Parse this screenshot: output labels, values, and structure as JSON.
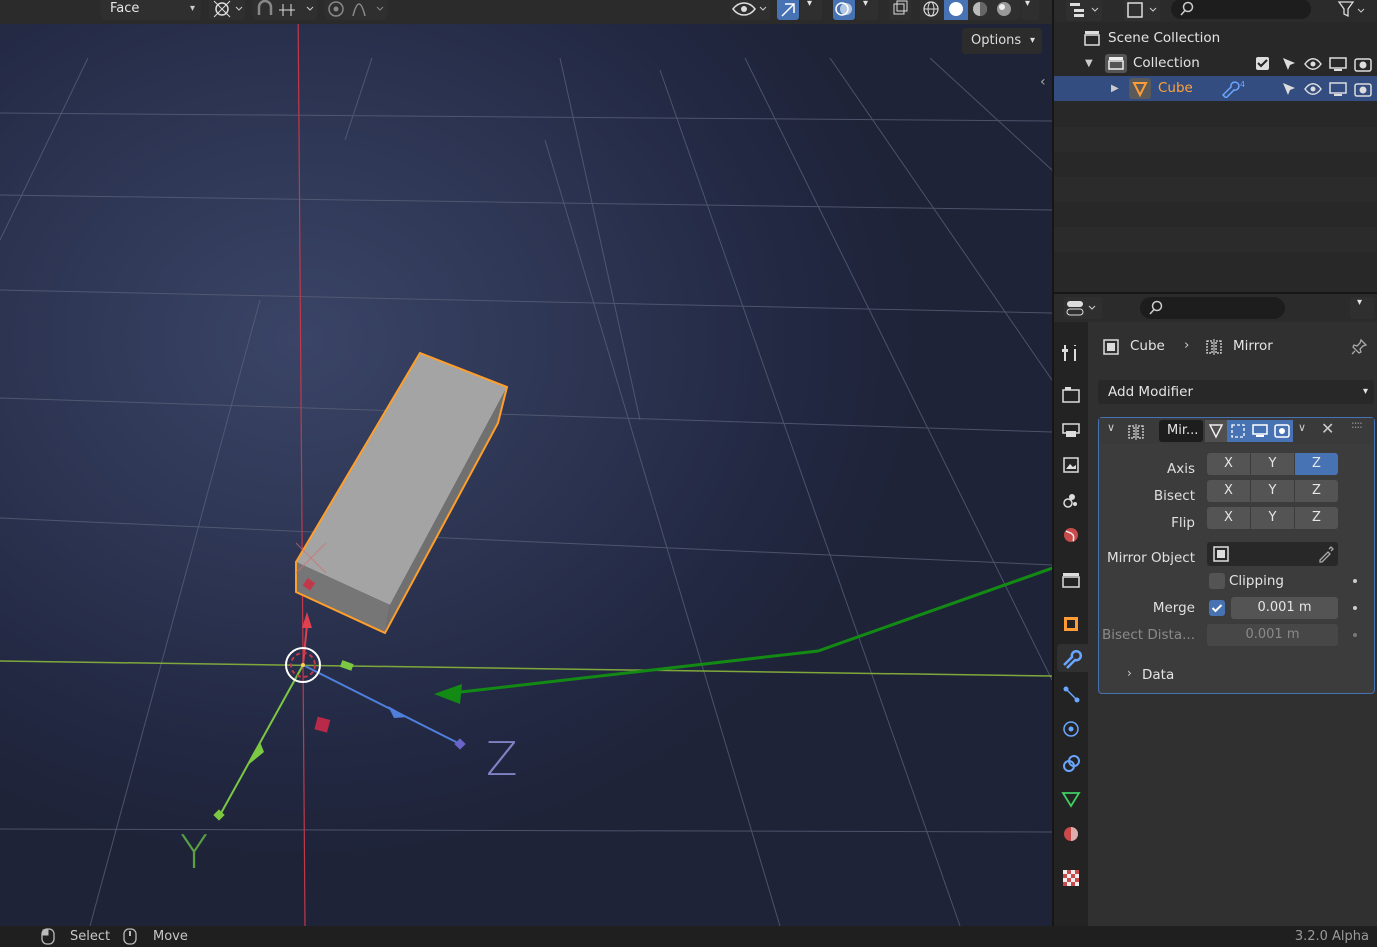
{
  "viewport_header": {
    "mode_select": "Face",
    "options_label": "Options"
  },
  "viewport": {
    "axis_z_label": "Z",
    "axis_y_label": "Y"
  },
  "outliner": {
    "rows": [
      {
        "label": "Scene Collection"
      },
      {
        "label": "Collection"
      },
      {
        "label": "Cube"
      }
    ]
  },
  "properties": {
    "breadcrumb_object": "Cube",
    "breadcrumb_modifier": "Mirror",
    "add_modifier_label": "Add Modifier",
    "modifier_name": "Mir...",
    "axis_label": "Axis",
    "bisect_label": "Bisect",
    "flip_label": "Flip",
    "x": "X",
    "y": "Y",
    "z": "Z",
    "mirror_object_label": "Mirror Object",
    "clipping_label": "Clipping",
    "merge_label": "Merge",
    "merge_value": "0.001 m",
    "bisect_distance_label": "Bisect Dista...",
    "bisect_distance_value": "0.001 m",
    "data_label": "Data",
    "axis_active": "Z",
    "merge_checked": true,
    "clipping_checked": false
  },
  "status_bar": {
    "select_label": "Select",
    "move_label": "Move",
    "version": "3.2.0 Alpha"
  },
  "colors": {
    "accent_blue": "#4772b3",
    "selected_orange": "#ffa33a",
    "annotation_green": "#138a13"
  }
}
